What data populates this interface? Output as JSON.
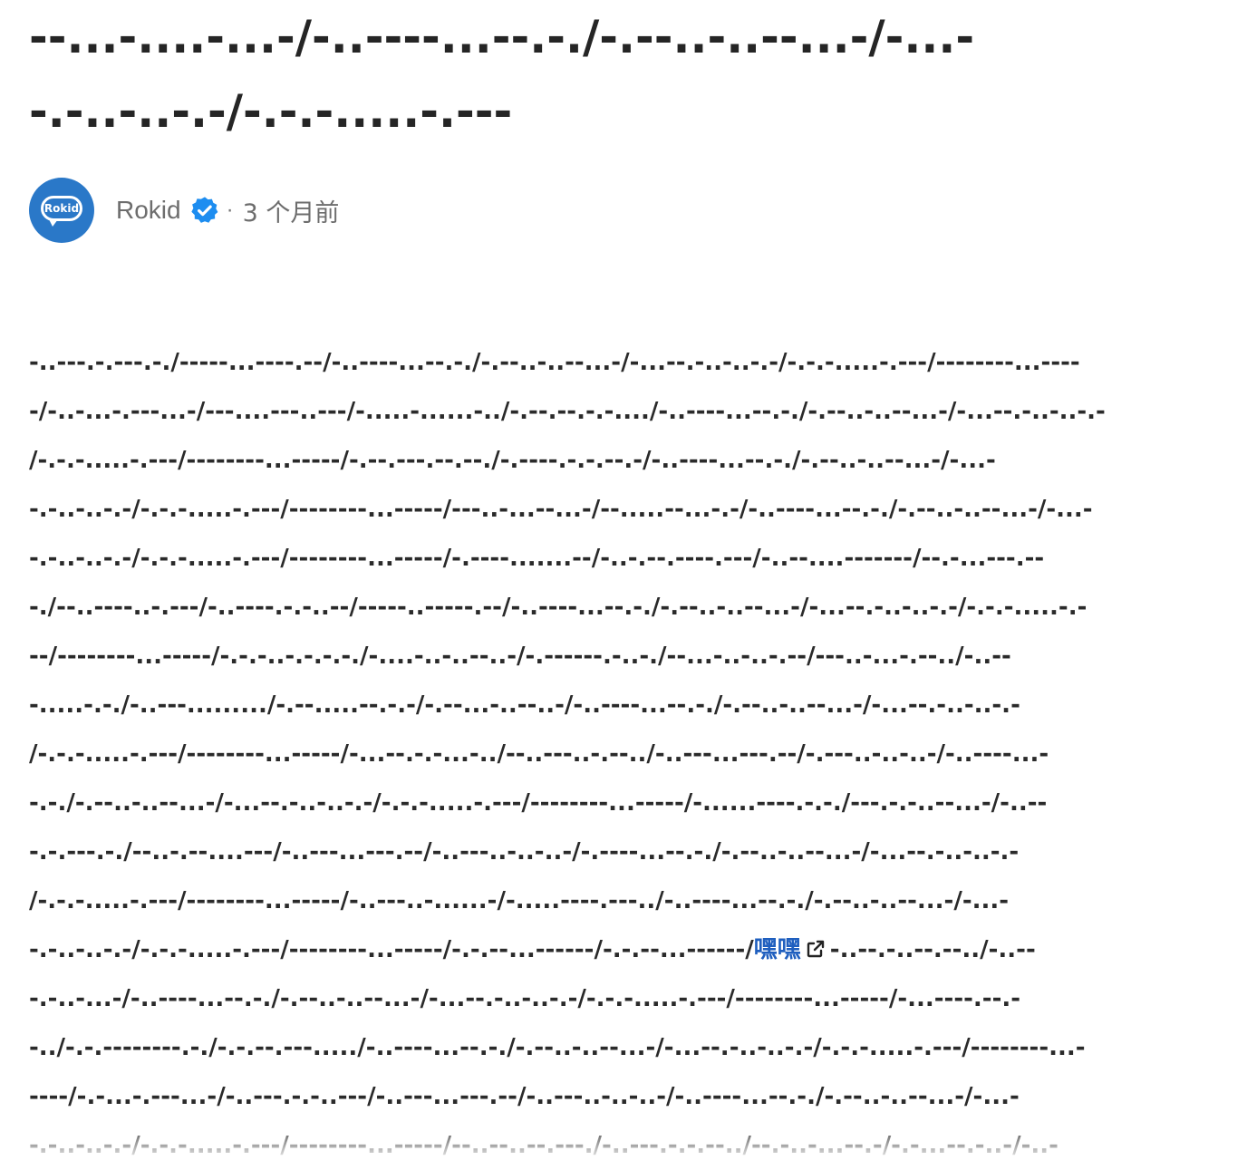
{
  "article": {
    "title_lines": [
      "--...-....-...-/-..----...--.-./-.--..-..--...-/-...-",
      "-.-..-..-.-/-.-.-.....-.---"
    ]
  },
  "author": {
    "name": "Rokid",
    "avatar_text": "Rokid",
    "separator": "·",
    "time": "3 个月前"
  },
  "body": {
    "lines": [
      "-..---.-.---.-./-----...----.--/-..----...--.-./-.--..-..--...-/-...--.-..-..-.-/-.-.-.....-.---/--------...----",
      "-/-..-...-.---...-/---....---..---/-.....-......-../-.--.--.-.-..../-..----...--.-./-.--..-..--...-/-...--.-..-..-.-",
      "/-.-.-.....-.---/--------...-----/-.--.---.--.--./-.----.-.-.--.-/-..----...--.-./-.--..-..--...-/-...-",
      "-.-..-..-.-/-.-.-.....-.---/--------...-----/---..-...--...-/--.....--...-.-/-..----...--.-./-.--..-..--...-/-...-",
      "-.-..-..-.-/-.-.-.....-.---/--------...-----/-.----.......--/-..-.--.----.---/-..--....-------/--.-...---.--",
      "-./--..----..-.---/-..----.-.-..--/-----..-----.--/-..----...--.-./-.--..-..--...-/-...--.-..-..-.-/-.-.-.....-.-",
      "--/--------...-----/-.-.-..-.-.-.-./-....-..-..--..-/-.------.-..-./--...-..-..-.--/---..-...-.--../-..--",
      "-.....-.-./-..---........./-.--.....--.-.-/-.--...-..--..-/-..----...--.-./-.--..-..--...-/-...--.-..-..-.-",
      "/-.-.-.....-.---/--------...-----/-...--.-.-...-../--..---..-.--../-..---...---.--/-.---..-..-..-/-..----...-",
      "-.-./-.--..-..--...-/-...--.-..-..-.-/-.-.-.....-.---/--------...-----/-......----.-.-./---.-.-..--...-/-..--",
      "-.-.---.-./--..-.--....---/-..---...---.--/-..---..-..-..-/-.----...--.-./-.--..-..--...-/-...--.-..-..-.-",
      "/-.-.-.....-.---/--------...-----/-..---..-......-/-.....----.---../-..----...--.-./-.--..-..--...-/-...-",
      "-.-..-..-.-/-.-.-.....-.---/--------...-----/-.-.--...------/-.-.--...------/",
      "-.-..-...-/-..----...--.-./-.--..-..--...-/-...--.-..-..-.-/-.-.-.....-.---/--------...-----/-...----.--.-",
      "-../-.-.--------.-./-.-.--.---...../-..----...--.-./-.--..-..--...-/-...--.-..-..-.-/-.-.-.....-.---/--------...-",
      "----/-.-...-.---...-/-..---.-.-..---/-..---...---.--/-..---..-..-..-/-..----...--.-./-.--..-..--...-/-...-",
      "-.-..-..-.-/-.-.-.....-.---/--------...-----/--..--..--.---./-..---.-.-.--../--.-..-...--.-/-.-...--.-..-/-..-"
    ],
    "link_text": "嘿嘿",
    "link_after": "-..--.-..--.--../-..--"
  },
  "colors": {
    "link": "#1f5fbf",
    "avatar_bg": "#2a78c8",
    "verified": "#1d8df0"
  }
}
